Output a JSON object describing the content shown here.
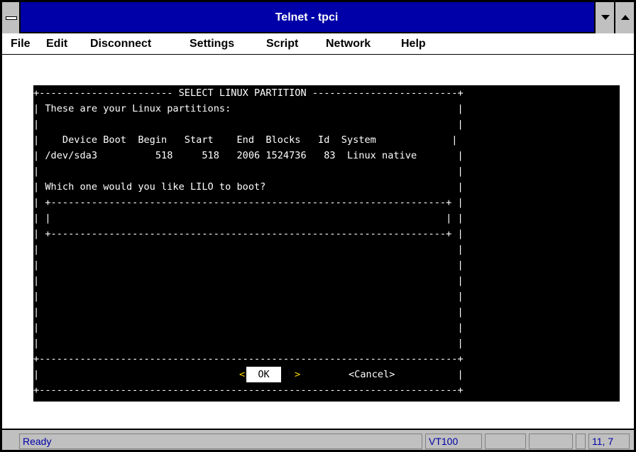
{
  "window": {
    "title": "Telnet - tpci"
  },
  "menu": {
    "items": [
      "File",
      "Edit",
      "Disconnect",
      "Settings",
      "Script",
      "Network",
      "Help"
    ]
  },
  "terminal": {
    "box_top": "+----------------------- SELECT LINUX PARTITION -------------------------+",
    "prompt_intro": "| These are your Linux partitions:                                       |",
    "blank": "|                                                                        |",
    "header_row": "|    Device Boot  Begin   Start    End  Blocks   Id  System             |",
    "partition_row": "| /dev/sda3          518     518   2006 1524736   83  Linux native       |",
    "question": "| Which one would you like LILO to boot?                                 |",
    "input_top": "| +--------------------------------------------------------------------+ |",
    "input_mid": "| |                                                                    | |",
    "input_bottom": "| +--------------------------------------------------------------------+ |",
    "divider": "+------------------------------------------------------------------------+",
    "button_row_frame": "|                                                                        |",
    "box_bottom": "+------------------------------------------------------------------------+",
    "ok_left": "<",
    "ok_label": "  OK  ",
    "ok_right": ">",
    "cancel_label": "<Cancel>"
  },
  "status": {
    "ready": "Ready",
    "emulation": "VT100",
    "position": "11, 7"
  },
  "colors": {
    "title_bar": "#0000a8",
    "terminal_bg": "#000000",
    "terminal_fg": "#ffffff",
    "ok_arrow": "#ffd400",
    "status_text": "#0000a8"
  }
}
